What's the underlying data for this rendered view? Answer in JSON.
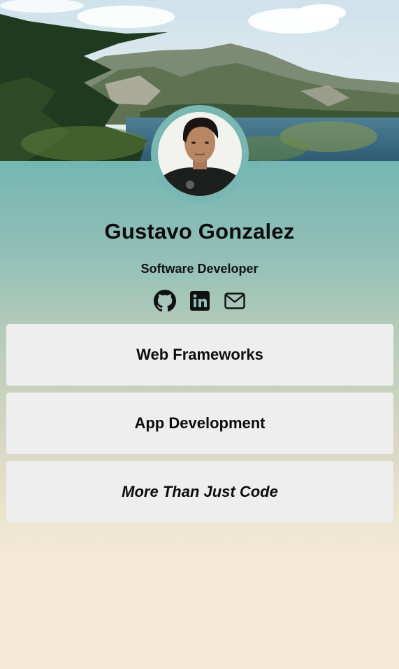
{
  "profile": {
    "name": "Gustavo Gonzalez",
    "role": "Software Developer"
  },
  "socials": [
    {
      "icon": "github-icon"
    },
    {
      "icon": "linkedin-icon"
    },
    {
      "icon": "mail-icon"
    }
  ],
  "cards": [
    {
      "label": "Web Frameworks"
    },
    {
      "label": "App Development"
    },
    {
      "label": "More Than Just Code"
    }
  ],
  "colors": {
    "teal": "#75b6b1",
    "cream": "#f6ead7",
    "card": "#eeeeee"
  }
}
